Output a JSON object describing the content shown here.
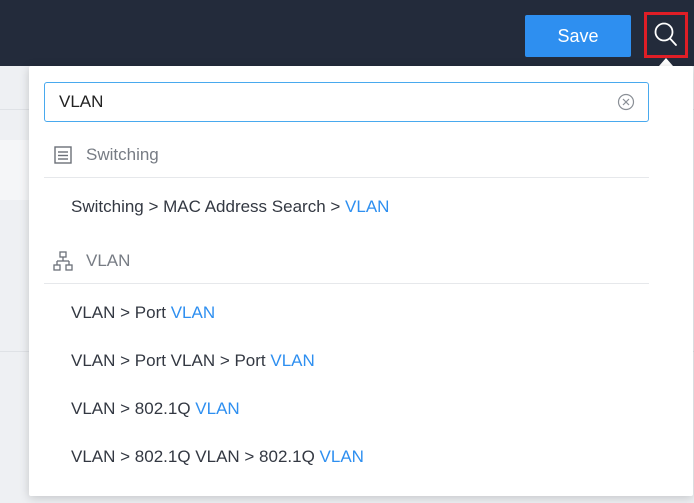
{
  "topbar": {
    "save_label": "Save",
    "search_icon": "search-icon",
    "highlight_color": "#e01e26"
  },
  "search": {
    "value": "VLAN",
    "placeholder": "",
    "clear_icon": "clear-circle-icon"
  },
  "groups": [
    {
      "title": "Switching",
      "icon": "switching-list-icon",
      "results": [
        {
          "prefix": "Switching > MAC Address Search > ",
          "match": "VLAN"
        }
      ]
    },
    {
      "title": "VLAN",
      "icon": "network-topology-icon",
      "results": [
        {
          "prefix": "VLAN > Port ",
          "match": "VLAN"
        },
        {
          "prefix": "VLAN > Port VLAN > Port ",
          "match": "VLAN"
        },
        {
          "prefix": "VLAN > 802.1Q ",
          "match": "VLAN"
        },
        {
          "prefix": "VLAN > 802.1Q VLAN > 802.1Q ",
          "match": "VLAN"
        }
      ]
    }
  ],
  "colors": {
    "topbar_bg": "#232b3b",
    "accent": "#2e8ff0",
    "match_text": "#2e8ff0"
  }
}
